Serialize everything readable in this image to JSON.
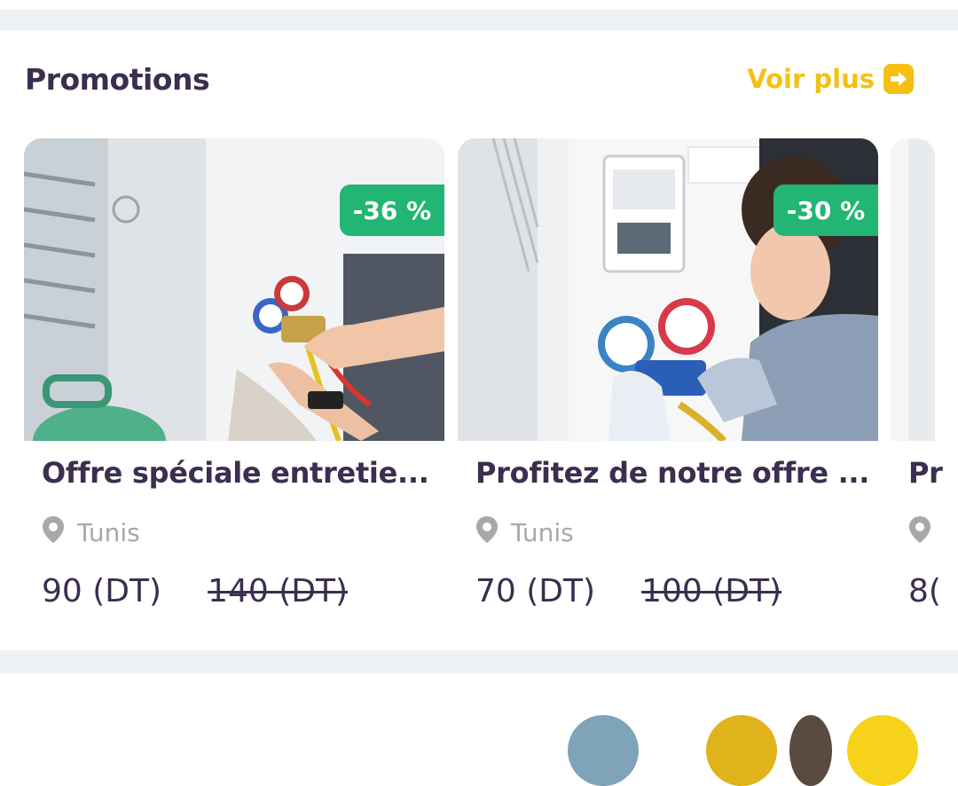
{
  "section": {
    "title": "Promotions",
    "see_more": "Voir plus"
  },
  "currency": "(DT)",
  "offers": [
    {
      "title": "Offre spéciale entretie...",
      "discount": "-36 %",
      "location": "Tunis",
      "price": "90 (DT)",
      "old_price": "140 (DT)"
    },
    {
      "title": "Profitez de notre offre ...",
      "discount": "-30 %",
      "location": "Tunis",
      "price": "70 (DT)",
      "old_price": "100 (DT)"
    },
    {
      "title": "Pr",
      "price": "8("
    }
  ],
  "colors": {
    "accent": "#f5c013",
    "discount_badge": "#22b574",
    "title_text": "#3b2e4f",
    "muted_text": "#a8a8a8",
    "section_band": "#eef1f5"
  }
}
